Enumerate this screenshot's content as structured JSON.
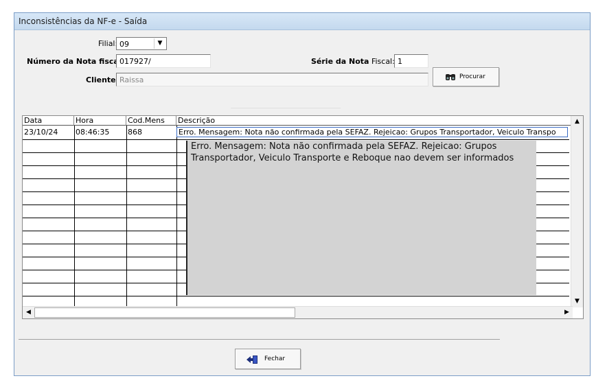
{
  "window": {
    "title": "Inconsistências da NF-e - Saída"
  },
  "form": {
    "filial_label": "Filial:",
    "filial_value": "09",
    "numero_label": "Número da Nota fiscal:",
    "numero_value": "017927/",
    "serie_label_bold": "Série da Nota",
    "serie_label_rest": "Fiscal:",
    "serie_value": "1",
    "cliente_label": "Cliente:",
    "cliente_value": "Raissa"
  },
  "buttons": {
    "procurar": "Procurar",
    "fechar": "Fechar"
  },
  "grid": {
    "columns": [
      "Data",
      "Hora",
      "Cod.Mens",
      "Descrição"
    ],
    "rows": [
      {
        "data": "23/10/24",
        "hora": "08:46:35",
        "cod": "868",
        "descricao": "Erro. Mensagem: Nota não confirmada pela SEFAZ. Rejeicao: Grupos Transportador, Veiculo Transpo"
      }
    ],
    "tooltip_line1": "Erro. Mensagem: Nota não confirmada pela SEFAZ. Rejeicao: Grupos",
    "tooltip_line2": "Transportador, Veiculo Transporte e Reboque nao devem ser informados"
  },
  "icons": {
    "procurar": "binoculars-icon",
    "fechar": "exit-door-icon"
  }
}
